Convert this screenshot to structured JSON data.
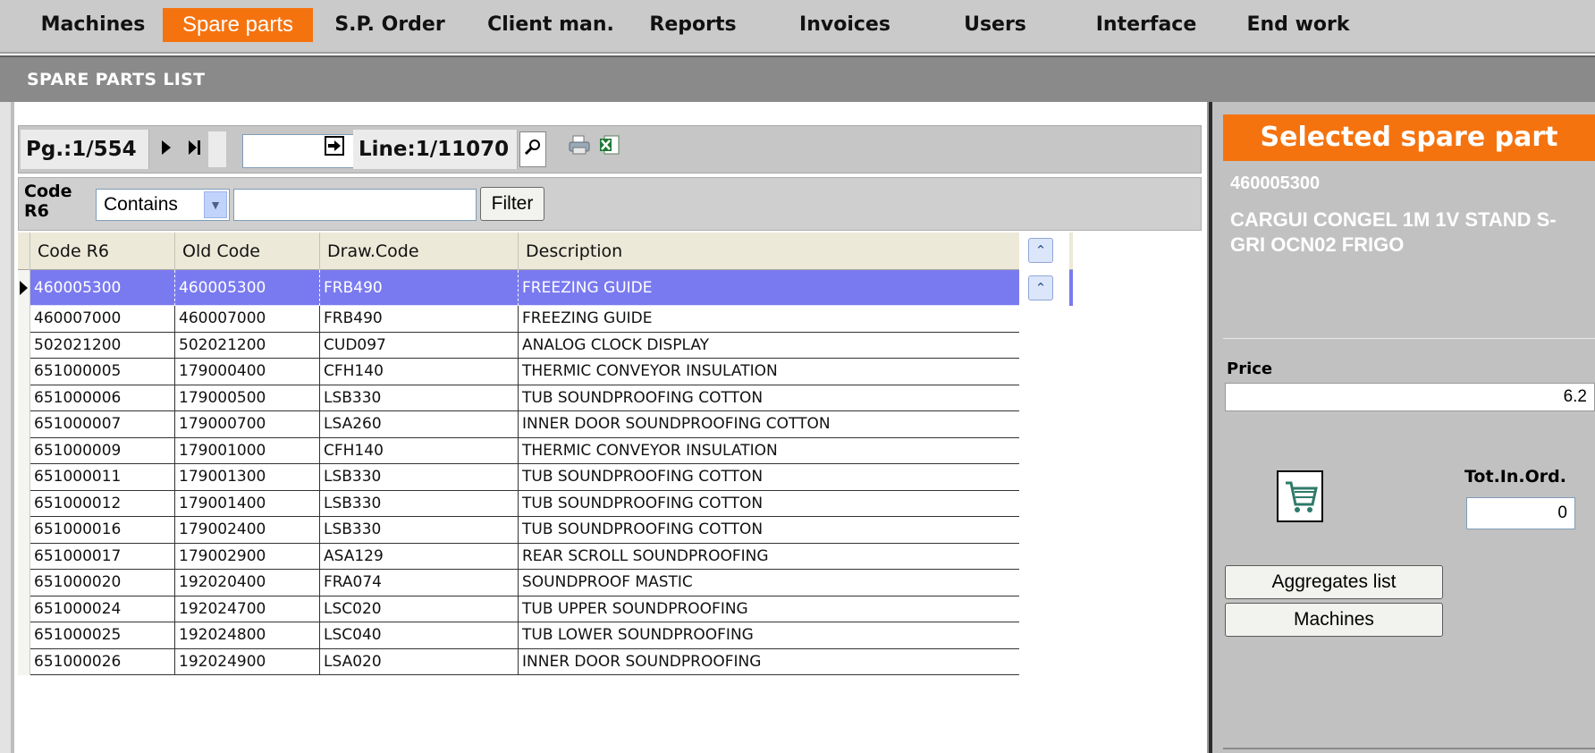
{
  "nav": {
    "items": [
      {
        "label": "Machines"
      },
      {
        "label": "Spare parts"
      },
      {
        "label": "S.P. Order"
      },
      {
        "label": "Client man."
      },
      {
        "label": "Reports"
      },
      {
        "label": "Invoices"
      },
      {
        "label": "Users"
      },
      {
        "label": "Interface"
      },
      {
        "label": "End work"
      }
    ],
    "active": "Spare parts"
  },
  "section": {
    "title": "SPARE PARTS LIST"
  },
  "toolbar": {
    "page": "Pg.:1/554",
    "page_input": "",
    "line": "Line:1/11070"
  },
  "filter": {
    "field_label_1": "Code",
    "field_label_2": "R6",
    "match_mode": "Contains",
    "value": "",
    "button": "Filter"
  },
  "table": {
    "columns": [
      "Code R6",
      "Old Code",
      "Draw.Code",
      "Description"
    ],
    "rows": [
      [
        "460005300",
        "460005300",
        "FRB490",
        "FREEZING GUIDE"
      ],
      [
        "460007000",
        "460007000",
        "FRB490",
        "FREEZING GUIDE"
      ],
      [
        "502021200",
        "502021200",
        "CUD097",
        "ANALOG CLOCK DISPLAY"
      ],
      [
        "651000005",
        "179000400",
        "CFH140",
        "THERMIC CONVEYOR INSULATION"
      ],
      [
        "651000006",
        "179000500",
        "LSB330",
        "TUB SOUNDPROOFING COTTON"
      ],
      [
        "651000007",
        "179000700",
        "LSA260",
        "INNER DOOR SOUNDPROOFING COTTON"
      ],
      [
        "651000009",
        "179001000",
        "CFH140",
        "THERMIC CONVEYOR INSULATION"
      ],
      [
        "651000011",
        "179001300",
        "LSB330",
        "TUB SOUNDPROOFING COTTON"
      ],
      [
        "651000012",
        "179001400",
        "LSB330",
        "TUB SOUNDPROOFING COTTON"
      ],
      [
        "651000016",
        "179002400",
        "LSB330",
        "TUB SOUNDPROOFING COTTON"
      ],
      [
        "651000017",
        "179002900",
        "ASA129",
        "REAR SCROLL SOUNDPROOFING"
      ],
      [
        "651000020",
        "192020400",
        "FRA074",
        "SOUNDPROOF MASTIC"
      ],
      [
        "651000024",
        "192024700",
        "LSC020",
        "TUB UPPER SOUNDPROOFING"
      ],
      [
        "651000025",
        "192024800",
        "LSC040",
        "TUB LOWER SOUNDPROOFING"
      ],
      [
        "651000026",
        "192024900",
        "LSA020",
        "INNER DOOR SOUNDPROOFING"
      ]
    ],
    "selected_index": 0
  },
  "selected": {
    "title": "Selected spare part",
    "code": "460005300",
    "description": "CARGUI CONGEL 1M 1V STAND S-GRI OCN02 FRIGO",
    "price_label": "Price",
    "price": "6.2",
    "tot_label": "Tot.In.Ord.",
    "tot": "0",
    "buttons": [
      "Aggregates list",
      "Machines"
    ]
  },
  "colors": {
    "accent": "#f5730f",
    "selection": "#7a7af0",
    "panel": "#c1c1c1"
  },
  "icons": [
    "play-icon",
    "last-page-icon",
    "goto-icon",
    "search-icon",
    "print-icon",
    "excel-icon",
    "scroll-top-icon",
    "scroll-up-icon",
    "cart-icon"
  ]
}
